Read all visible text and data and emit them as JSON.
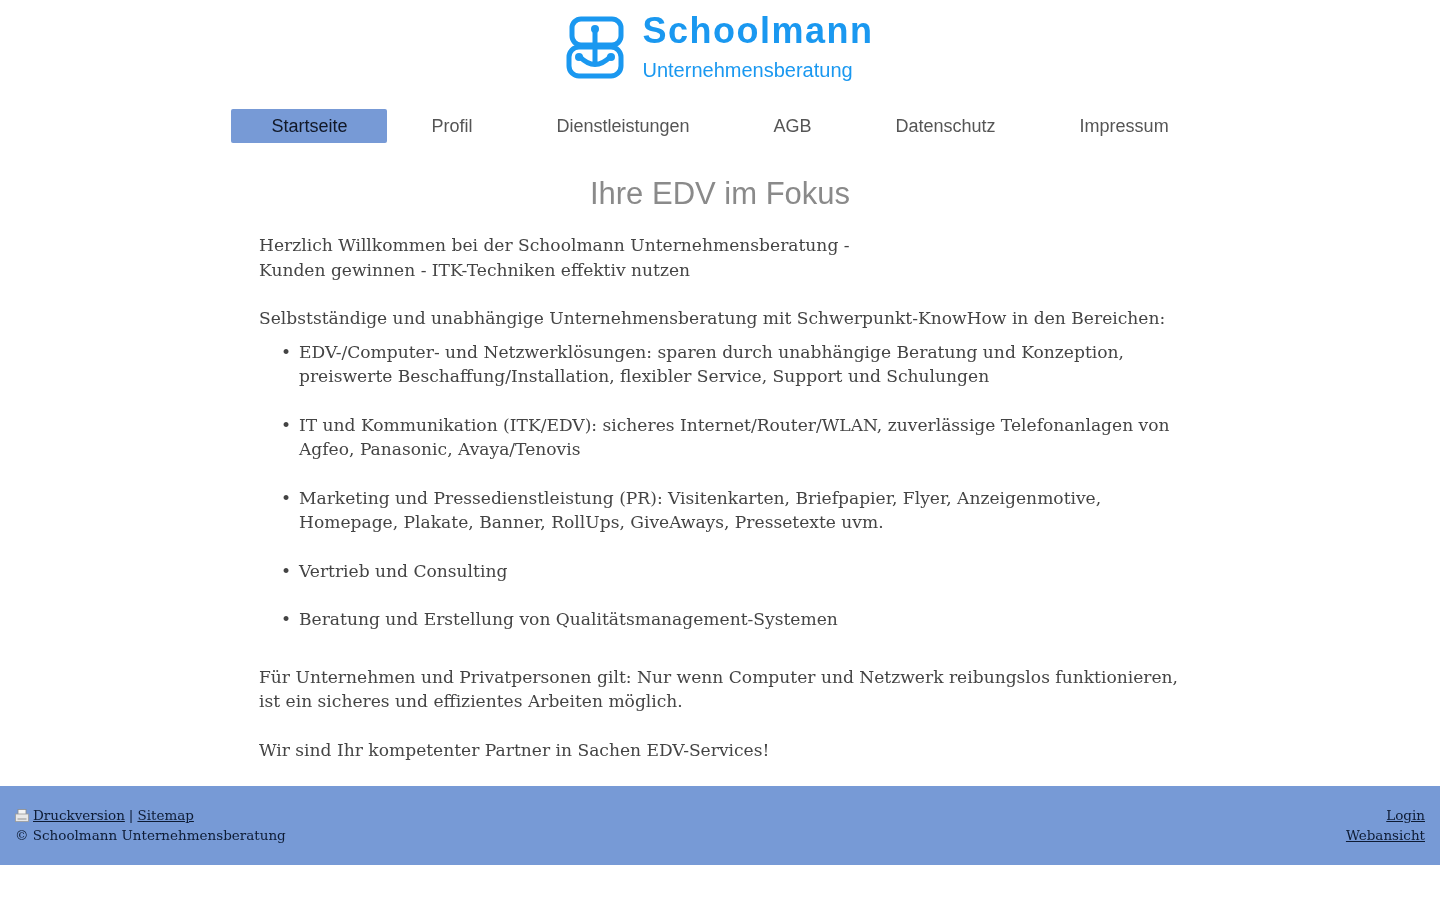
{
  "logo": {
    "name": "Schoolmann",
    "tagline": "Unternehmensberatung"
  },
  "nav": [
    {
      "label": "Startseite",
      "selected": true
    },
    {
      "label": "Profil",
      "selected": false
    },
    {
      "label": "Dienstleistungen",
      "selected": false
    },
    {
      "label": "AGB",
      "selected": false
    },
    {
      "label": "Datenschutz",
      "selected": false
    },
    {
      "label": "Impressum",
      "selected": false
    }
  ],
  "heading": "Ihre EDV im Fokus",
  "intro": [
    "Herzlich Willkommen bei der Schoolmann Unternehmensberatung -",
    "Kunden gewinnen - ITK-Techniken effektiv nutzen"
  ],
  "lead": "Selbstständige und unabhängige Unternehmensberatung mit Schwerpunkt-KnowHow in den Bereichen:",
  "services": {
    "bullet": "•",
    "items": [
      "EDV-/Computer- und Netzwerklösungen: sparen durch unabhängige Beratung und Konzeption, preiswerte Beschaffung/Installation, flexibler Service, Support und Schulungen",
      "IT und Kommunikation (ITK/EDV): sicheres Internet/Router/WLAN, zuverlässige Telefonanlagen von Agfeo, Panasonic, Avaya/Tenovis",
      "Marketing und Pressedienstleistung (PR): Visitenkarten, Briefpapier, Flyer, Anzeigenmotive, Homepage, Plakate, Banner, RollUps, GiveAways, Pressetexte uvm.",
      "Vertrieb und Consulting",
      "Beratung und Erstellung von Qualitätsmanagement-Systemen"
    ]
  },
  "closing": [
    "Für Unternehmen und Privatpersonen gilt: Nur wenn Computer und Netzwerk reibungslos funktionieren, ist ein sicheres und effizientes Arbeiten möglich.",
    "Wir sind Ihr kompetenter Partner in Sachen EDV-Services!"
  ],
  "footer": {
    "links": [
      "Druckversion",
      "Sitemap"
    ],
    "separator": "|",
    "copyright": "© Schoolmann Unternehmensberatung",
    "right_links": [
      "Login",
      "Webansicht"
    ]
  }
}
